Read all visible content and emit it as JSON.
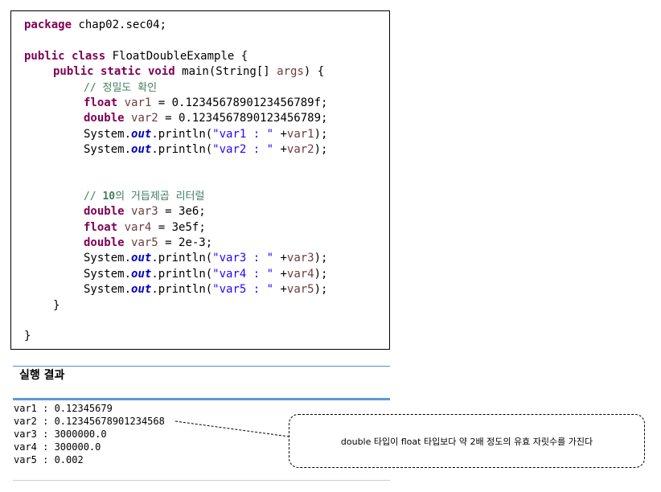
{
  "code": {
    "line1_kw": "package",
    "line1_rest": " chap02.sec04;",
    "line2_kw": "public class",
    "line2_rest": " FloatDoubleExample {",
    "line3_kw": "public static void",
    "line3_rest": " main(String[] ",
    "line3_args": "args",
    "line3_end": ") {",
    "comment1": "// 정밀도 확인",
    "line5_type": "float",
    "line5_var": "var1",
    "line5_rest": " = 0.1234567890123456789f;",
    "line6_type": "double",
    "line6_var": "var2",
    "line6_rest": " = 0.1234567890123456789;",
    "sysout_system": "System.",
    "sysout_out": "out",
    "sysout_println": ".println(",
    "str_var1": "\"var1 : \"",
    "arg_var1": "var1",
    "str_var2": "\"var2 : \"",
    "arg_var2": "var2",
    "comment2_prefix": "// ",
    "comment2_num": "10",
    "comment2_rest": "의 거듭제곱 리터럴",
    "line11_type": "double",
    "line11_var": "var3",
    "line11_rest": " = 3e6;",
    "line12_type": "float",
    "line12_var": "var4",
    "line12_rest": " = 3e5f;",
    "line13_type": "double",
    "line13_var": "var5",
    "line13_rest": " = 2e-3;",
    "str_var3": "\"var3 : \"",
    "arg_var3": "var3",
    "str_var4": "\"var4 : \"",
    "arg_var4": "var4",
    "str_var5": "\"var5 : \"",
    "arg_var5": "var5",
    "plus": " +",
    "stmt_end": ");",
    "close_method": "}",
    "close_class": "}"
  },
  "result": {
    "title": "실행 결과",
    "lines": [
      "var1 : 0.12345679",
      "var2 : 0.12345678901234568",
      "var3 : 3000000.0",
      "var4 : 300000.0",
      "var5 : 0.002"
    ]
  },
  "callout": {
    "text": "double 타입이 float 타입보다 약 2배 정도의 유효 자릿수를 가진다"
  },
  "colors": {
    "keyword": "#7f0055",
    "variable": "#6a3e3e",
    "string": "#2a00ff",
    "static_field": "#0000c0",
    "comment": "#3f7f5f",
    "accent_line": "#5b9bd5"
  }
}
